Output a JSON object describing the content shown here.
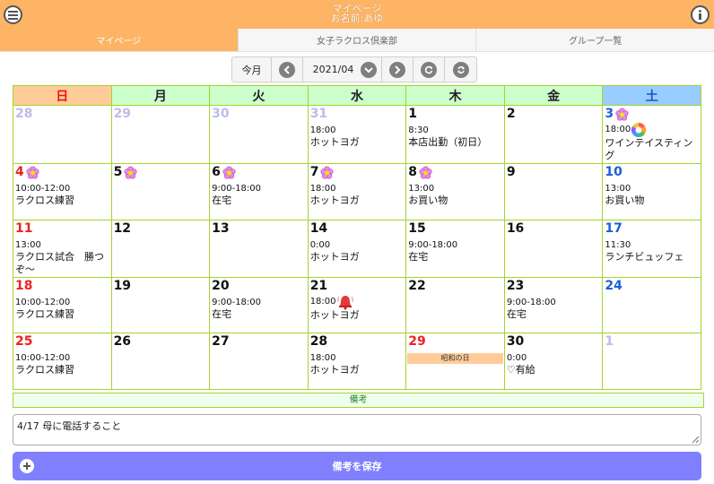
{
  "header": {
    "title": "マイページ",
    "subtitle": "お名前:あゆ"
  },
  "tabs": [
    {
      "label": "マイページ",
      "active": true
    },
    {
      "label": "女子ラクロス倶楽部",
      "active": false
    },
    {
      "label": "グループ一覧",
      "active": false
    }
  ],
  "toolbar": {
    "today_label": "今月",
    "month_value": "2021/04"
  },
  "calendar": {
    "weekdays": [
      "日",
      "月",
      "火",
      "水",
      "木",
      "金",
      "土"
    ],
    "weeks": [
      [
        {
          "day": "28",
          "other": true
        },
        {
          "day": "29",
          "other": true
        },
        {
          "day": "30",
          "other": true
        },
        {
          "day": "31",
          "other": true,
          "time": "18:00",
          "title": "ホットヨガ"
        },
        {
          "day": "1",
          "time": "8:30",
          "title": "本店出勤（初日）"
        },
        {
          "day": "2"
        },
        {
          "day": "3",
          "flower": true,
          "time": "18:00",
          "title": "ワインテイスティング",
          "badge": "rainbow"
        }
      ],
      [
        {
          "day": "4",
          "flower": true,
          "time": "10:00-12:00",
          "title": "ラクロス練習"
        },
        {
          "day": "5",
          "flower": true
        },
        {
          "day": "6",
          "flower": true,
          "time": "9:00-18:00",
          "title": "在宅"
        },
        {
          "day": "7",
          "flower": true,
          "time": "18:00",
          "title": "ホットヨガ"
        },
        {
          "day": "8",
          "flower": true,
          "time": "13:00",
          "title": "お買い物"
        },
        {
          "day": "9"
        },
        {
          "day": "10",
          "time": "13:00",
          "title": "お買い物"
        }
      ],
      [
        {
          "day": "11",
          "time": "13:00",
          "title": "ラクロス試合　勝つぞ～"
        },
        {
          "day": "12"
        },
        {
          "day": "13"
        },
        {
          "day": "14",
          "time": "0:00",
          "title": "ホットヨガ"
        },
        {
          "day": "15",
          "time": "9:00-18:00",
          "title": "在宅"
        },
        {
          "day": "16"
        },
        {
          "day": "17",
          "time": "11:30",
          "title": "ランチビュッフェ"
        }
      ],
      [
        {
          "day": "18",
          "time": "10:00-12:00",
          "title": "ラクロス練習"
        },
        {
          "day": "19"
        },
        {
          "day": "20",
          "time": "9:00-18:00",
          "title": "在宅"
        },
        {
          "day": "21",
          "time": "18:00",
          "title": "ホットヨガ",
          "badge": "bell"
        },
        {
          "day": "22"
        },
        {
          "day": "23",
          "time": "9:00-18:00",
          "title": "在宅"
        },
        {
          "day": "24"
        }
      ],
      [
        {
          "day": "25",
          "time": "10:00-12:00",
          "title": "ラクロス練習"
        },
        {
          "day": "26"
        },
        {
          "day": "27"
        },
        {
          "day": "28",
          "time": "18:00",
          "title": "ホットヨガ"
        },
        {
          "day": "29",
          "holiday": "昭和の日"
        },
        {
          "day": "30",
          "time": "0:00",
          "title": "♡有給"
        },
        {
          "day": "1",
          "other": true
        }
      ]
    ]
  },
  "notes": {
    "label": "備考",
    "value": "4/17 母に電話すること"
  },
  "save_button": {
    "label": "備考を保存"
  },
  "colors": {
    "header": "#fdb464",
    "grid": "#a6d42c",
    "sunday": "#ee2222",
    "saturday": "#1a5fd8",
    "save": "#8080ff"
  }
}
